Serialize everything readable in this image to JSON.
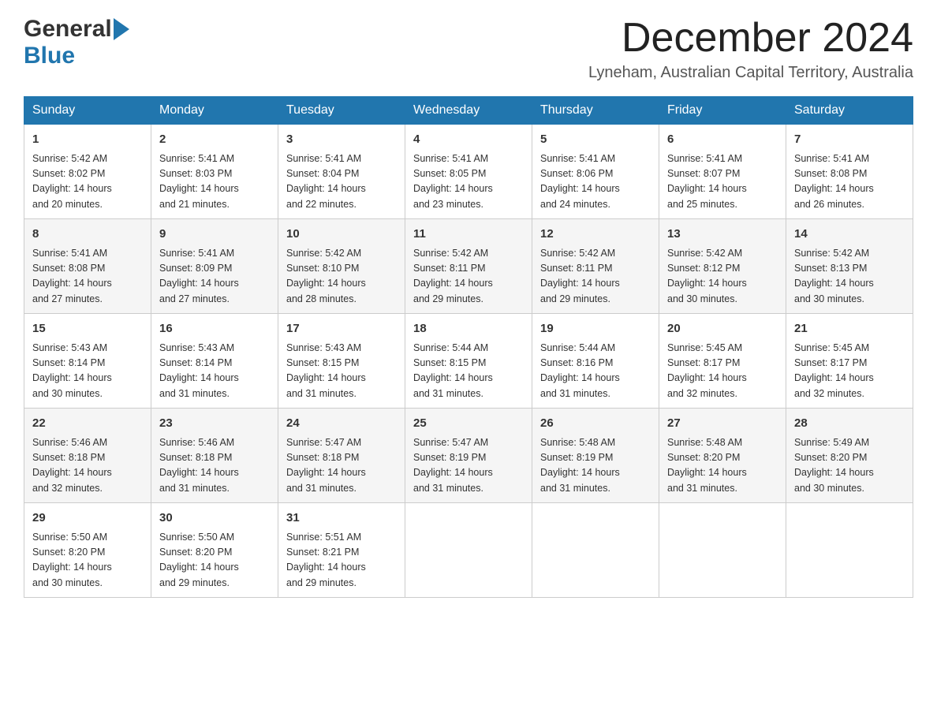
{
  "header": {
    "logo_general": "General",
    "logo_blue": "Blue",
    "month_title": "December 2024",
    "location": "Lyneham, Australian Capital Territory, Australia"
  },
  "days_of_week": [
    "Sunday",
    "Monday",
    "Tuesday",
    "Wednesday",
    "Thursday",
    "Friday",
    "Saturday"
  ],
  "weeks": [
    [
      {
        "day": "1",
        "sunrise": "5:42 AM",
        "sunset": "8:02 PM",
        "daylight": "14 hours and 20 minutes."
      },
      {
        "day": "2",
        "sunrise": "5:41 AM",
        "sunset": "8:03 PM",
        "daylight": "14 hours and 21 minutes."
      },
      {
        "day": "3",
        "sunrise": "5:41 AM",
        "sunset": "8:04 PM",
        "daylight": "14 hours and 22 minutes."
      },
      {
        "day": "4",
        "sunrise": "5:41 AM",
        "sunset": "8:05 PM",
        "daylight": "14 hours and 23 minutes."
      },
      {
        "day": "5",
        "sunrise": "5:41 AM",
        "sunset": "8:06 PM",
        "daylight": "14 hours and 24 minutes."
      },
      {
        "day": "6",
        "sunrise": "5:41 AM",
        "sunset": "8:07 PM",
        "daylight": "14 hours and 25 minutes."
      },
      {
        "day": "7",
        "sunrise": "5:41 AM",
        "sunset": "8:08 PM",
        "daylight": "14 hours and 26 minutes."
      }
    ],
    [
      {
        "day": "8",
        "sunrise": "5:41 AM",
        "sunset": "8:08 PM",
        "daylight": "14 hours and 27 minutes."
      },
      {
        "day": "9",
        "sunrise": "5:41 AM",
        "sunset": "8:09 PM",
        "daylight": "14 hours and 27 minutes."
      },
      {
        "day": "10",
        "sunrise": "5:42 AM",
        "sunset": "8:10 PM",
        "daylight": "14 hours and 28 minutes."
      },
      {
        "day": "11",
        "sunrise": "5:42 AM",
        "sunset": "8:11 PM",
        "daylight": "14 hours and 29 minutes."
      },
      {
        "day": "12",
        "sunrise": "5:42 AM",
        "sunset": "8:11 PM",
        "daylight": "14 hours and 29 minutes."
      },
      {
        "day": "13",
        "sunrise": "5:42 AM",
        "sunset": "8:12 PM",
        "daylight": "14 hours and 30 minutes."
      },
      {
        "day": "14",
        "sunrise": "5:42 AM",
        "sunset": "8:13 PM",
        "daylight": "14 hours and 30 minutes."
      }
    ],
    [
      {
        "day": "15",
        "sunrise": "5:43 AM",
        "sunset": "8:14 PM",
        "daylight": "14 hours and 30 minutes."
      },
      {
        "day": "16",
        "sunrise": "5:43 AM",
        "sunset": "8:14 PM",
        "daylight": "14 hours and 31 minutes."
      },
      {
        "day": "17",
        "sunrise": "5:43 AM",
        "sunset": "8:15 PM",
        "daylight": "14 hours and 31 minutes."
      },
      {
        "day": "18",
        "sunrise": "5:44 AM",
        "sunset": "8:15 PM",
        "daylight": "14 hours and 31 minutes."
      },
      {
        "day": "19",
        "sunrise": "5:44 AM",
        "sunset": "8:16 PM",
        "daylight": "14 hours and 31 minutes."
      },
      {
        "day": "20",
        "sunrise": "5:45 AM",
        "sunset": "8:17 PM",
        "daylight": "14 hours and 32 minutes."
      },
      {
        "day": "21",
        "sunrise": "5:45 AM",
        "sunset": "8:17 PM",
        "daylight": "14 hours and 32 minutes."
      }
    ],
    [
      {
        "day": "22",
        "sunrise": "5:46 AM",
        "sunset": "8:18 PM",
        "daylight": "14 hours and 32 minutes."
      },
      {
        "day": "23",
        "sunrise": "5:46 AM",
        "sunset": "8:18 PM",
        "daylight": "14 hours and 31 minutes."
      },
      {
        "day": "24",
        "sunrise": "5:47 AM",
        "sunset": "8:18 PM",
        "daylight": "14 hours and 31 minutes."
      },
      {
        "day": "25",
        "sunrise": "5:47 AM",
        "sunset": "8:19 PM",
        "daylight": "14 hours and 31 minutes."
      },
      {
        "day": "26",
        "sunrise": "5:48 AM",
        "sunset": "8:19 PM",
        "daylight": "14 hours and 31 minutes."
      },
      {
        "day": "27",
        "sunrise": "5:48 AM",
        "sunset": "8:20 PM",
        "daylight": "14 hours and 31 minutes."
      },
      {
        "day": "28",
        "sunrise": "5:49 AM",
        "sunset": "8:20 PM",
        "daylight": "14 hours and 30 minutes."
      }
    ],
    [
      {
        "day": "29",
        "sunrise": "5:50 AM",
        "sunset": "8:20 PM",
        "daylight": "14 hours and 30 minutes."
      },
      {
        "day": "30",
        "sunrise": "5:50 AM",
        "sunset": "8:20 PM",
        "daylight": "14 hours and 29 minutes."
      },
      {
        "day": "31",
        "sunrise": "5:51 AM",
        "sunset": "8:21 PM",
        "daylight": "14 hours and 29 minutes."
      },
      null,
      null,
      null,
      null
    ]
  ],
  "labels": {
    "sunrise": "Sunrise:",
    "sunset": "Sunset:",
    "daylight": "Daylight:"
  },
  "colors": {
    "header_bg": "#2176ae",
    "header_text": "#ffffff",
    "border": "#cccccc",
    "accent_blue": "#2176ae"
  }
}
